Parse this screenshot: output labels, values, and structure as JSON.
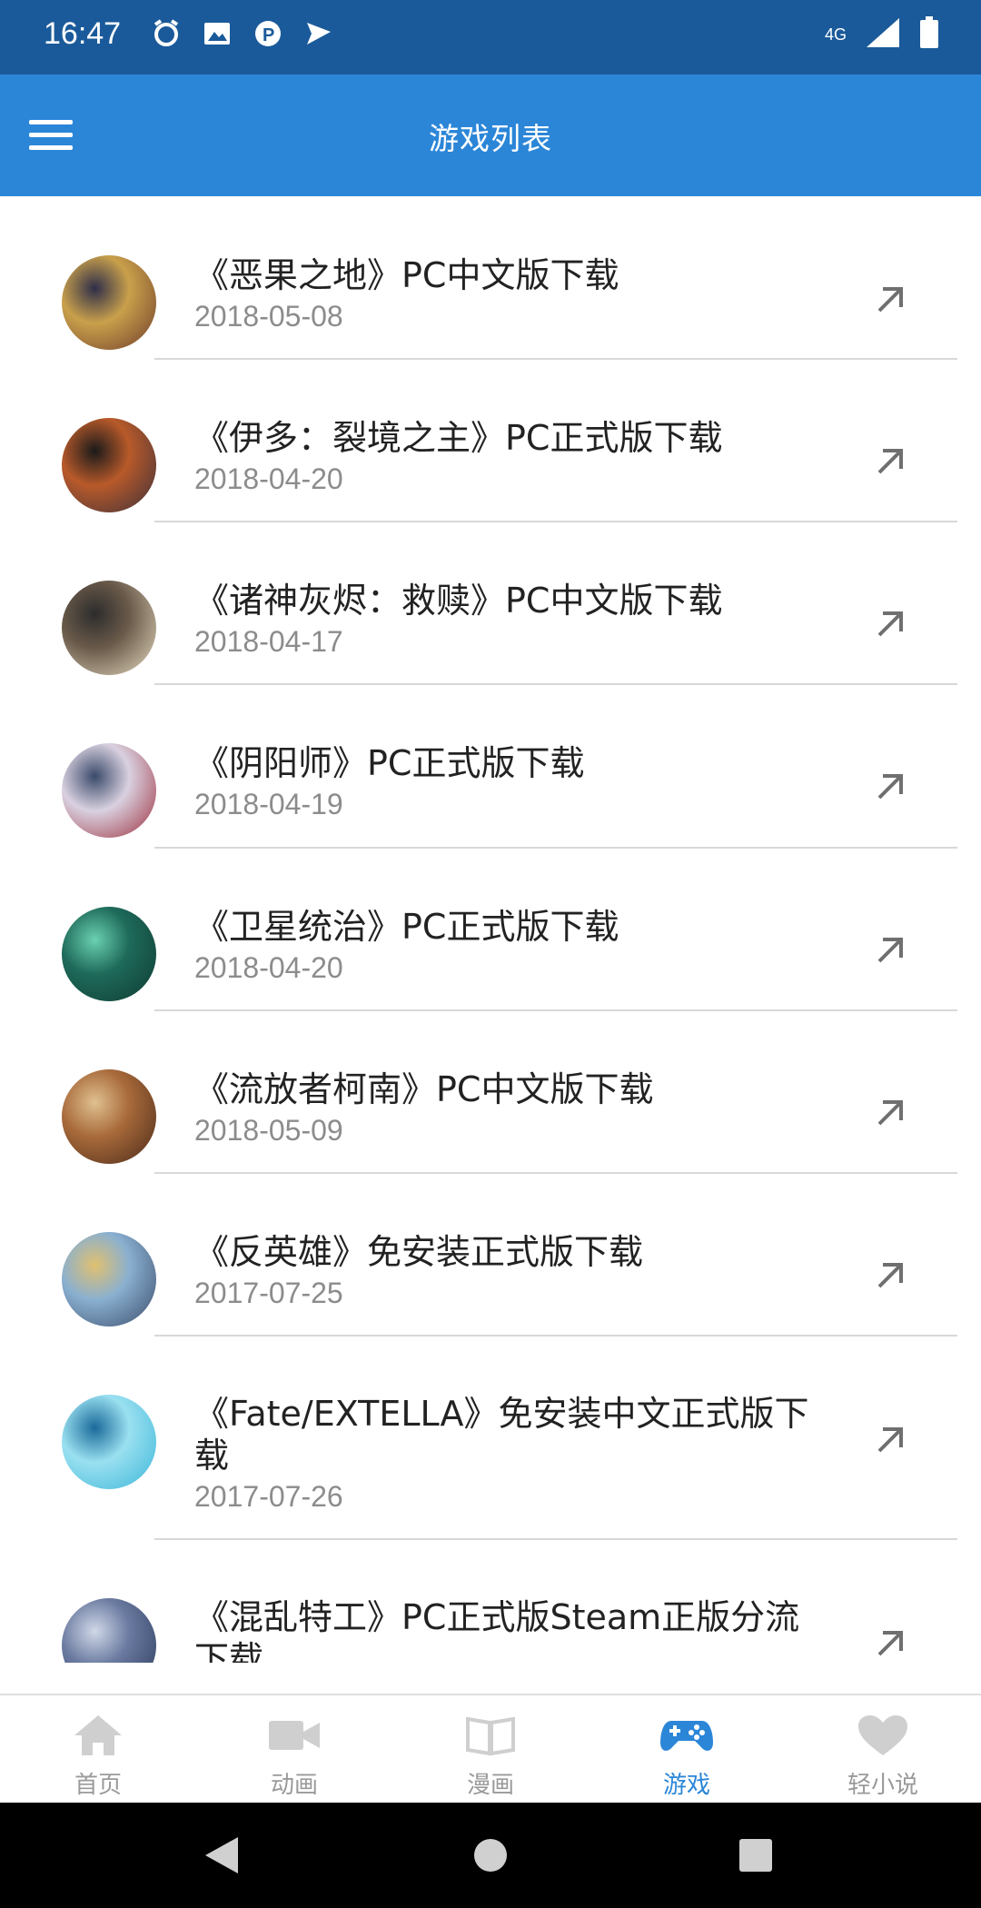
{
  "status_bar": {
    "time": "16:47",
    "network": "4G",
    "icons_left": [
      "alarm-icon",
      "image-icon",
      "parking-icon",
      "send-icon"
    ]
  },
  "app_bar": {
    "title": "游戏列表"
  },
  "games": [
    {
      "title": "《恶果之地》PC中文版下载",
      "date": "2018-05-08",
      "thumb_colors": [
        "#6e3b2a",
        "#c9a04b",
        "#2e2e4a"
      ]
    },
    {
      "title": "《伊多：裂境之主》PC正式版下载",
      "date": "2018-04-20",
      "thumb_colors": [
        "#3b2f3a",
        "#b85a2a",
        "#1a1a1a"
      ]
    },
    {
      "title": "《诸神灰烬：救赎》PC中文版下载",
      "date": "2018-04-17",
      "thumb_colors": [
        "#e7dcc1",
        "#6a5a4a",
        "#2c2c2c"
      ]
    },
    {
      "title": "《阴阳师》PC正式版下载",
      "date": "2018-04-19",
      "thumb_colors": [
        "#9c2c3a",
        "#d9d1e0",
        "#3a4a6a"
      ]
    },
    {
      "title": "《卫星统治》PC正式版下载",
      "date": "2018-04-20",
      "thumb_colors": [
        "#0f3a32",
        "#1e6a5a",
        "#6ad0b0"
      ]
    },
    {
      "title": "《流放者柯南》PC中文版下载",
      "date": "2018-05-09",
      "thumb_colors": [
        "#4a2a1a",
        "#a86a3a",
        "#e0c090"
      ]
    },
    {
      "title": "《反英雄》免安装正式版下载",
      "date": "2017-07-25",
      "thumb_colors": [
        "#3a4a6a",
        "#8ab0d0",
        "#e0c070"
      ]
    },
    {
      "title": "《Fate/EXTELLA》免安装中文正式版下载",
      "date": "2017-07-26",
      "thumb_colors": [
        "#3ab6d8",
        "#9ae0f0",
        "#1a6a9a"
      ]
    },
    {
      "title": "《混乱特工》PC正式版Steam正版分流下载",
      "date": "",
      "thumb_colors": [
        "#2a3a5a",
        "#6a7aa0",
        "#d0d8e8"
      ]
    }
  ],
  "bottom_nav": {
    "items": [
      {
        "label": "首页",
        "icon": "home-icon"
      },
      {
        "label": "动画",
        "icon": "video-camera-icon"
      },
      {
        "label": "漫画",
        "icon": "book-icon"
      },
      {
        "label": "游戏",
        "icon": "gamepad-icon"
      },
      {
        "label": "轻小说",
        "icon": "heart-icon"
      }
    ],
    "active_index": 3,
    "active_color": "#2b86d8",
    "inactive_color": "#9a9a9a"
  },
  "colors": {
    "status_bar": "#1a5a9a",
    "app_bar": "#2b86d8"
  }
}
